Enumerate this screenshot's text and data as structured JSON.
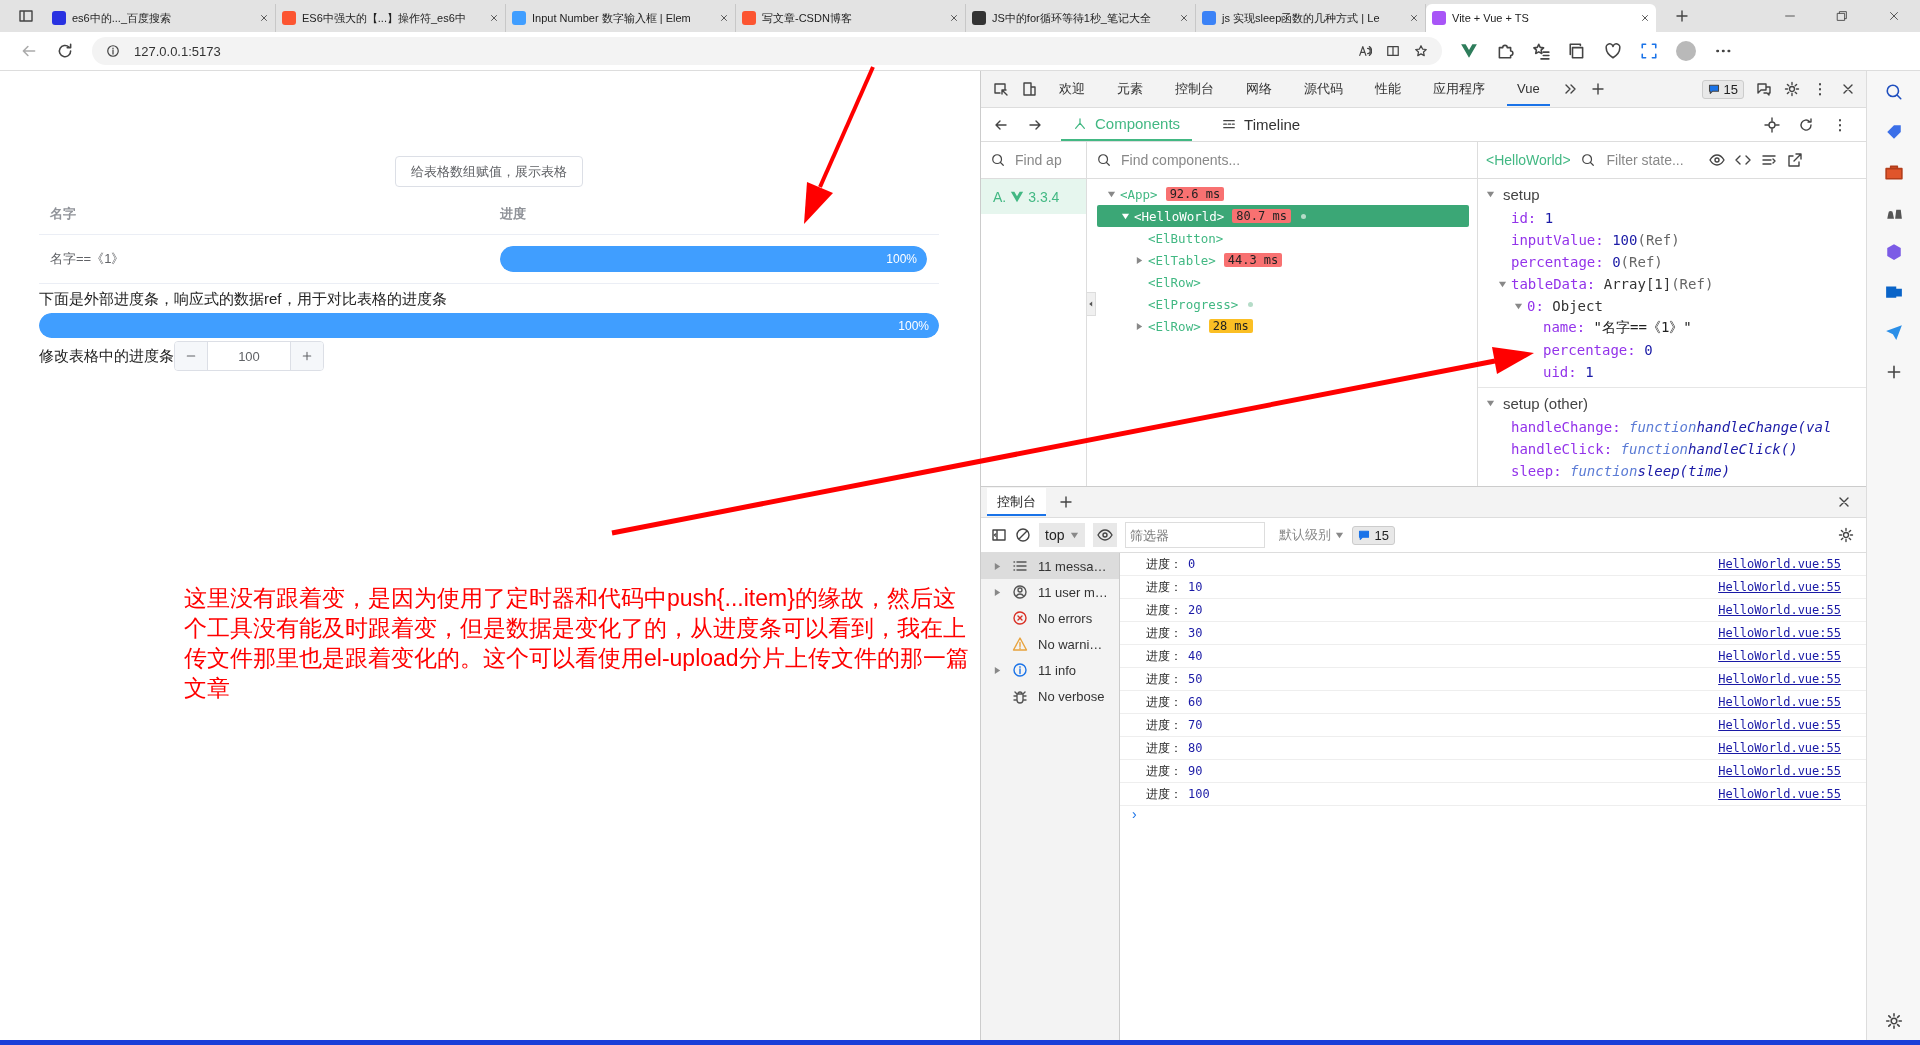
{
  "browser": {
    "tabs": [
      {
        "title": "es6中的..._百度搜索",
        "selected": false,
        "color": "#2932e1"
      },
      {
        "title": "ES6中强大的【...】操作符_es6中",
        "selected": false,
        "color": "#fc5531"
      },
      {
        "title": "Input Number 数字输入框 | Elem",
        "selected": false,
        "color": "#409eff"
      },
      {
        "title": "写文章-CSDN博客",
        "selected": false,
        "color": "#fc5531"
      },
      {
        "title": "JS中的for循环等待1秒_笔记大全",
        "selected": false,
        "color": "#333333"
      },
      {
        "title": "js 实现sleep函数的几种方式 | Le",
        "selected": false,
        "color": "#3b82f6"
      },
      {
        "title": "Vite + Vue + TS",
        "selected": true,
        "color": "#a855f7"
      }
    ],
    "address": "127.0.0.1:5173"
  },
  "page": {
    "button": "给表格数组赋值，展示表格",
    "table": {
      "columns": [
        "名字",
        "进度"
      ],
      "rows": [
        {
          "name": "名字==《1》",
          "level": 1,
          "reading": "100%"
        }
      ]
    },
    "caption": "下面是外部进度条，响应式的数据ref，用于对比表格的进度条",
    "progress": {
      "level": 1,
      "reading": "100%"
    },
    "input": {
      "label": "修改表格中的进度条",
      "value": "100"
    }
  },
  "annotation": "这里没有跟着变，是因为使用了定时器和代码中push{...item}的缘故，然后这个工具没有能及时跟着变，但是数据是变化了的，从进度条可以看到，我在上传文件那里也是跟着变化的。这个可以看使用el-upload分片上传文件的那一篇文章",
  "devtools": {
    "tabs": [
      {
        "label": "欢迎",
        "selected": false
      },
      {
        "label": "元素",
        "selected": false
      },
      {
        "label": "控制台",
        "selected": false
      },
      {
        "label": "网络",
        "selected": false
      },
      {
        "label": "源代码",
        "selected": false
      },
      {
        "label": "性能",
        "selected": false
      },
      {
        "label": "应用程序",
        "selected": false
      },
      {
        "label": "Vue",
        "selected": true
      }
    ],
    "issues_badge": "15",
    "vue_tabs": [
      {
        "label": "Components",
        "selected": true
      },
      {
        "label": "Timeline",
        "selected": false
      }
    ],
    "app_search": {
      "placeholder": "Find ap"
    },
    "apps": [
      {
        "name": "A.",
        "version": "3.3.4",
        "selected": true
      }
    ],
    "component_search": {
      "placeholder": "Find components..."
    },
    "tree": [
      {
        "name": "<App>",
        "timing": "92.6 ms",
        "color": "#f87171",
        "expanded": true,
        "selected": false,
        "dot": false,
        "children": [
          {
            "name": "<HelloWorld>",
            "timing": "80.7 ms",
            "color": "#f87171",
            "expanded": true,
            "selected": true,
            "dot": true,
            "children": [
              {
                "name": "<ElButton>",
                "selected": false,
                "dot": false
              },
              {
                "name": "<ElTable>",
                "timing": "44.3 ms",
                "color": "#f87171",
                "expanded": false,
                "selected": false,
                "dot": false
              },
              {
                "name": "<ElRow>",
                "selected": false,
                "dot": false
              },
              {
                "name": "<ElProgress>",
                "selected": false,
                "dot": true
              },
              {
                "name": "<ElRow>",
                "timing": "28 ms",
                "color": "#fbbf24",
                "expanded": false,
                "selected": false,
                "dot": false
              }
            ]
          }
        ]
      }
    ],
    "inspector": {
      "component": "<HelloWorld>",
      "filter": {
        "placeholder": "Filter state..."
      },
      "sections": [
        {
          "title": "setup",
          "expanded": true,
          "items": [
            {
              "key": "id:",
              "value": "1",
              "kind": "number"
            },
            {
              "key": "inputValue:",
              "value": "100",
              "kind": "number",
              "note": "(Ref)"
            },
            {
              "key": "percentage:",
              "value": "0",
              "kind": "number",
              "note": "(Ref)"
            },
            {
              "key": "tableData:",
              "value": "Array[1]",
              "kind": "object",
              "note": "(Ref)",
              "expanded": true,
              "children": [
                {
                  "key": "0:",
                  "value": "Object",
                  "kind": "object",
                  "expanded": true,
                  "children": [
                    {
                      "key": "name:",
                      "value": "\"名字==《1》\"",
                      "kind": "string"
                    },
                    {
                      "key": "percentage:",
                      "value": "0",
                      "kind": "number"
                    },
                    {
                      "key": "uid:",
                      "value": "1",
                      "kind": "number"
                    }
                  ]
                }
              ]
            }
          ]
        },
        {
          "title": "setup (other)",
          "expanded": true,
          "items": [
            {
              "key": "handleChange:",
              "type_label": "function",
              "value": "handleChange(val",
              "kind": "function"
            },
            {
              "key": "handleClick:",
              "type_label": "function",
              "value": "handleClick()",
              "kind": "function"
            },
            {
              "key": "sleep:",
              "type_label": "function",
              "value": "sleep(time)",
              "kind": "function"
            }
          ]
        }
      ]
    }
  },
  "console": {
    "tabs": [
      {
        "label": "控制台",
        "selected": true
      }
    ],
    "context": "top",
    "filter": {
      "placeholder": "筛选器"
    },
    "level": "默认级别",
    "badge": "15",
    "sidebar": [
      {
        "label": "11 messa…",
        "kind": "messages",
        "expandable": true,
        "selected": true
      },
      {
        "label": "11 user m…",
        "kind": "user",
        "expandable": true,
        "selected": false
      },
      {
        "label": "No errors",
        "kind": "error",
        "expandable": false,
        "selected": false
      },
      {
        "label": "No warni…",
        "kind": "warning",
        "expandable": false,
        "selected": false
      },
      {
        "label": "11 info",
        "kind": "info",
        "expandable": true,
        "selected": false
      },
      {
        "label": "No verbose",
        "kind": "verbose",
        "expandable": false,
        "selected": false
      }
    ],
    "messages": [
      {
        "label": "进度：",
        "value": "0",
        "source": "HelloWorld.vue:55"
      },
      {
        "label": "进度：",
        "value": "10",
        "source": "HelloWorld.vue:55"
      },
      {
        "label": "进度：",
        "value": "20",
        "source": "HelloWorld.vue:55"
      },
      {
        "label": "进度：",
        "value": "30",
        "source": "HelloWorld.vue:55"
      },
      {
        "label": "进度：",
        "value": "40",
        "source": "HelloWorld.vue:55"
      },
      {
        "label": "进度：",
        "value": "50",
        "source": "HelloWorld.vue:55"
      },
      {
        "label": "进度：",
        "value": "60",
        "source": "HelloWorld.vue:55"
      },
      {
        "label": "进度：",
        "value": "70",
        "source": "HelloWorld.vue:55"
      },
      {
        "label": "进度：",
        "value": "80",
        "source": "HelloWorld.vue:55"
      },
      {
        "label": "进度：",
        "value": "90",
        "source": "HelloWorld.vue:55"
      },
      {
        "label": "进度：",
        "value": "100",
        "source": "HelloWorld.vue:55"
      }
    ],
    "prompt": "›"
  }
}
